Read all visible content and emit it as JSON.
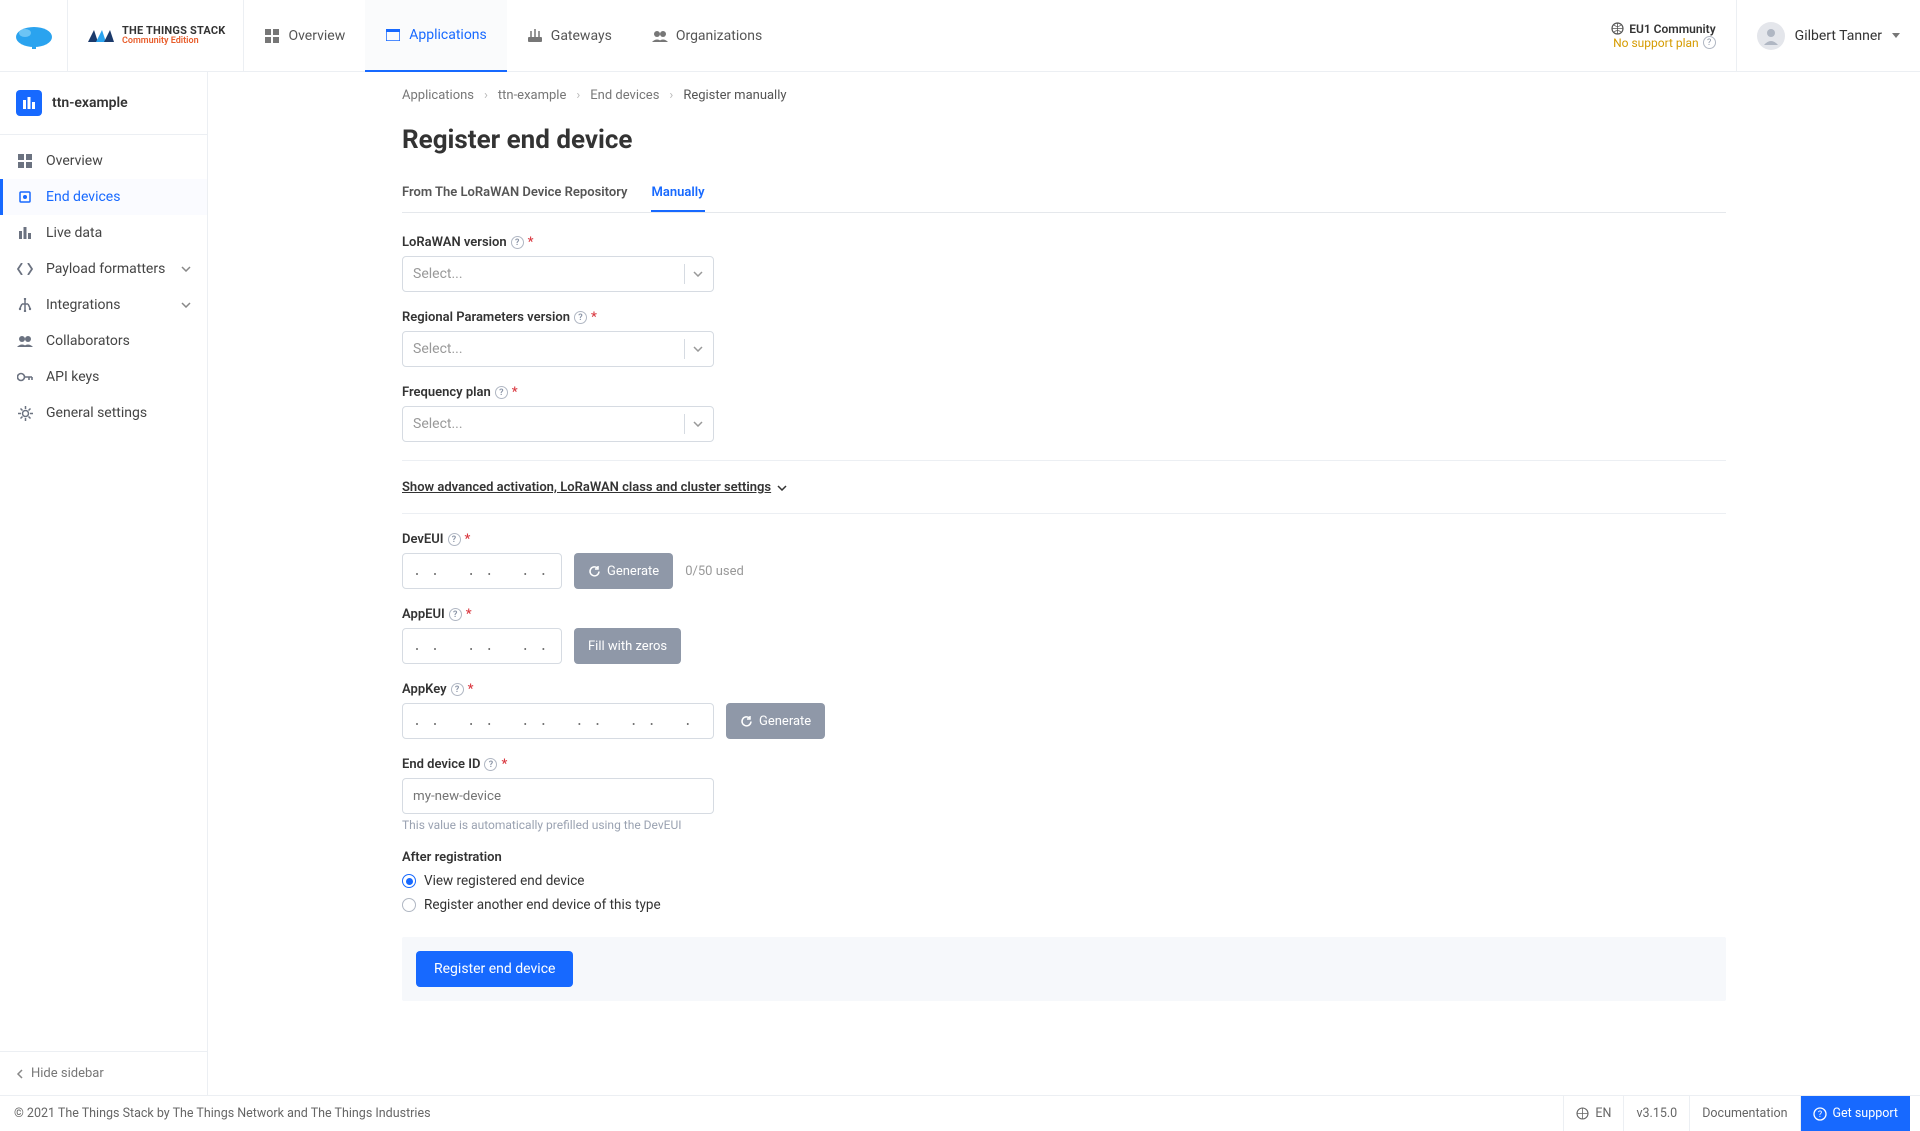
{
  "header": {
    "brand_title": "THE THINGS STACK",
    "brand_sub": "Community Edition",
    "tabs": {
      "overview": "Overview",
      "applications": "Applications",
      "gateways": "Gateways",
      "organizations": "Organizations"
    },
    "cluster": "EU1 Community",
    "no_plan": "No support plan",
    "user": "Gilbert Tanner"
  },
  "sidebar": {
    "app_name": "ttn-example",
    "items": {
      "overview": "Overview",
      "end_devices": "End devices",
      "live_data": "Live data",
      "payload": "Payload formatters",
      "integrations": "Integrations",
      "collaborators": "Collaborators",
      "api_keys": "API keys",
      "general": "General settings"
    },
    "hide": "Hide sidebar"
  },
  "crumbs": {
    "a": "Applications",
    "b": "ttn-example",
    "c": "End devices",
    "d": "Register manually"
  },
  "page_title": "Register end device",
  "subtabs": {
    "repo": "From The LoRaWAN Device Repository",
    "manual": "Manually"
  },
  "form": {
    "lorawan_label": "LoRaWAN version",
    "regional_label": "Regional Parameters version",
    "freq_label": "Frequency plan",
    "select_ph": "Select...",
    "advanced": "Show advanced activation, LoRaWAN class and cluster settings",
    "deveui_label": "DevEUI",
    "appeui_label": "AppEUI",
    "appkey_label": "AppKey",
    "byte8_ph": ". .   . .   . .   . .   . .   . .   . .   . .",
    "byte16_ph": ". .   . .   . .   . .   . .   . .   . .   . .   . .   . .   . .   . .   . .   . .   . .   . .",
    "generate": "Generate",
    "fill_zeros": "Fill with zeros",
    "used": "0/50 used",
    "devid_label": "End device ID",
    "devid_ph": "my-new-device",
    "devid_hint": "This value is automatically prefilled using the DevEUI",
    "after_label": "After registration",
    "view_after": "View registered end device",
    "register_more": "Register another end device of this type",
    "submit": "Register end device"
  },
  "footer": {
    "copy": "© 2021 The Things Stack by The Things Network and The Things Industries",
    "lang": "EN",
    "version": "v3.15.0",
    "docs": "Documentation",
    "support": "Get support"
  }
}
